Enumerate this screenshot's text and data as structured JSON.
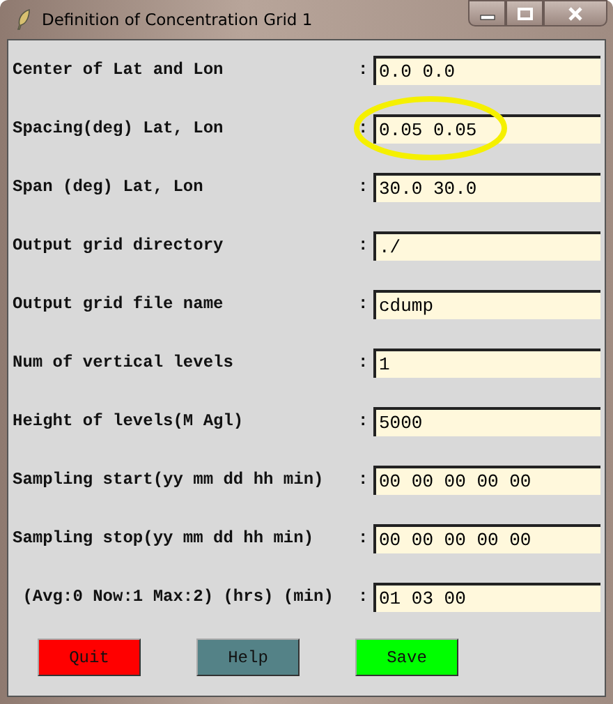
{
  "window": {
    "title": "Definition of Concentration Grid 1"
  },
  "rows": [
    {
      "label": "Center of Lat and Lon",
      "value": "0.0 0.0",
      "highlighted": false
    },
    {
      "label": "Spacing(deg) Lat, Lon",
      "value": "0.05 0.05",
      "highlighted": true
    },
    {
      "label": "Span (deg) Lat, Lon",
      "value": "30.0 30.0",
      "highlighted": false
    },
    {
      "label": "Output grid directory",
      "value": "./",
      "highlighted": false
    },
    {
      "label": "Output grid file name",
      "value": "cdump",
      "highlighted": false
    },
    {
      "label": "Num of vertical levels",
      "value": "1",
      "highlighted": false
    },
    {
      "label": "Height of levels(M Agl)",
      "value": "5000",
      "highlighted": false
    },
    {
      "label": "Sampling start(yy mm dd hh min)",
      "value": "00 00 00 00 00",
      "highlighted": false
    },
    {
      "label": "Sampling stop(yy mm dd hh min) ",
      "value": "00 00 00 00 00",
      "highlighted": false
    },
    {
      "label": " (Avg:0 Now:1 Max:2) (hrs) (min)",
      "value": "01 03 00",
      "highlighted": false
    }
  ],
  "separator": ":",
  "buttons": [
    {
      "label": "Quit",
      "color": "#ff0000"
    },
    {
      "label": "Help",
      "color": "#548287"
    },
    {
      "label": "Save",
      "color": "#00ff00"
    }
  ]
}
